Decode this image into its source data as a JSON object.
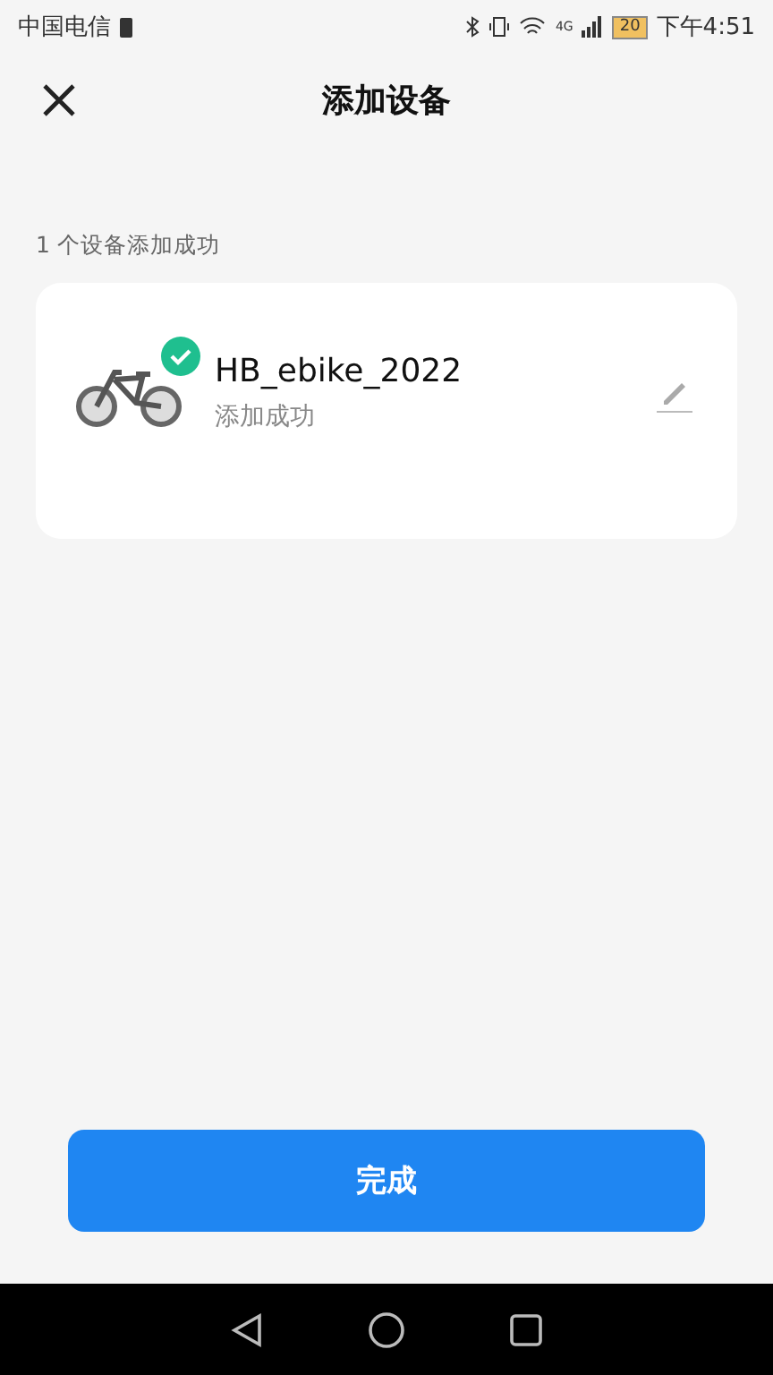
{
  "status_bar": {
    "carrier": "中国电信",
    "network": "4G",
    "battery": "20",
    "time": "下午4:51"
  },
  "header": {
    "title": "添加设备"
  },
  "summary": "1 个设备添加成功",
  "devices": [
    {
      "name": "HB_ebike_2022",
      "status": "添加成功",
      "added": true
    }
  ],
  "primary_button": "完成"
}
